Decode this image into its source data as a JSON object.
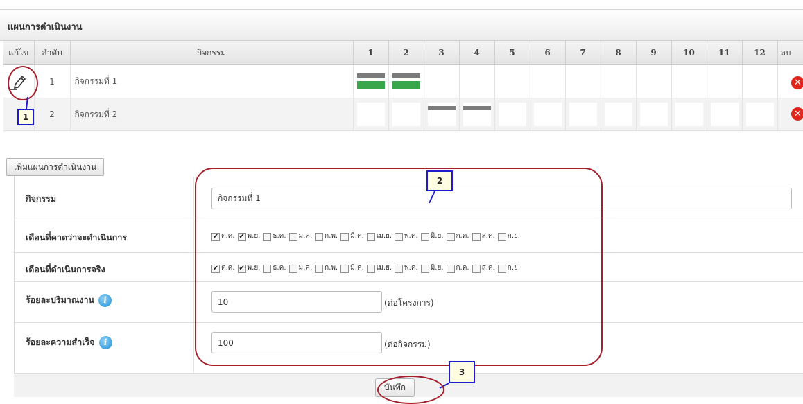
{
  "plan": {
    "title": "แผนการดำเนินงาน",
    "headers": {
      "edit": "แก้ไข",
      "order": "ลำดับ",
      "activity": "กิจกรรม",
      "months": [
        "1",
        "2",
        "3",
        "4",
        "5",
        "6",
        "7",
        "8",
        "9",
        "10",
        "11",
        "12"
      ],
      "delete": "ลบ"
    },
    "rows": [
      {
        "order": "1",
        "activity": "กิจกรรมที่ 1",
        "planned_months": [
          1,
          2
        ],
        "actual_months": [
          1,
          2
        ]
      },
      {
        "order": "2",
        "activity": "กิจกรรมที่ 2",
        "planned_months": [
          3,
          4
        ],
        "actual_months": []
      }
    ]
  },
  "form": {
    "add_button_label": "เพิ่มแผนการดำเนินงาน",
    "activity_label": "กิจกรรม",
    "activity_value": "กิจกรรมที่ 1",
    "expected_months_label": "เดือนที่คาดว่าจะดำเนินการ",
    "actual_months_label": "เดือนที่ดำเนินการจริง",
    "month_names": [
      "ต.ค.",
      "พ.ย.",
      "ธ.ค.",
      "ม.ค.",
      "ก.พ.",
      "มี.ค.",
      "เม.ย.",
      "พ.ค.",
      "มิ.ย.",
      "ก.ค.",
      "ส.ค.",
      "ก.ย."
    ],
    "expected_checked": [
      true,
      true,
      false,
      false,
      false,
      false,
      false,
      false,
      false,
      false,
      false,
      false
    ],
    "actual_checked": [
      true,
      true,
      false,
      false,
      false,
      false,
      false,
      false,
      false,
      false,
      false,
      false
    ],
    "work_percent_label": "ร้อยละปริมาณงาน",
    "work_percent_value": "10",
    "work_percent_hint": "(ต่อโครงการ)",
    "success_percent_label": "ร้อยละความสำเร็จ",
    "success_percent_value": "100",
    "success_percent_hint": "(ต่อกิจกรรม)",
    "save_label": "บันทึก"
  },
  "annotations": [
    "1",
    "2",
    "3"
  ],
  "colors": {
    "planned_bar": "#7b7b7b",
    "actual_bar": "#3aa64c",
    "annotation_ellipse": "#a41f2c",
    "callout_border": "#1c1ccc",
    "delete_icon": "#e0261c",
    "info_icon": "#1f8fd6"
  }
}
